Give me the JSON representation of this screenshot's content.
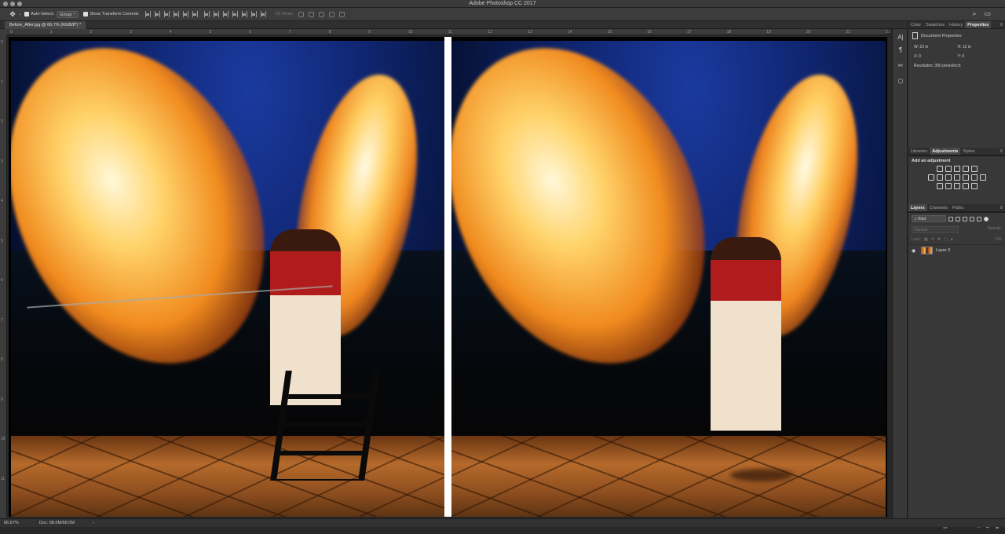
{
  "window": {
    "title": "Adobe Photoshop CC 2017"
  },
  "options_bar": {
    "auto_select_label": "Auto-Select:",
    "auto_select_value": "Group",
    "transform_label": "Show Transform Controls",
    "mode_3d_label": "3D Mode:"
  },
  "document": {
    "tab_title": "Before_After.jpg @ 66.7% (RGB/8*) *"
  },
  "rulers": {
    "h": [
      "0",
      "1",
      "2",
      "3",
      "4",
      "5",
      "6",
      "7",
      "8",
      "9",
      "10",
      "11",
      "12",
      "13",
      "14",
      "15",
      "16",
      "17",
      "18",
      "19",
      "20",
      "21",
      "22"
    ],
    "v": [
      "0",
      "1",
      "2",
      "3",
      "4",
      "5",
      "6",
      "7",
      "8",
      "9",
      "10",
      "11"
    ]
  },
  "properties_panel": {
    "tabs": [
      "Color",
      "Swatches",
      "History",
      "Properties"
    ],
    "active_tab": "Properties",
    "header": "Document Properties",
    "w": "W: 22 in",
    "h": "H: 12 in",
    "x": "X: 0",
    "y": "Y: 0",
    "resolution": "Resolution: 300 pixels/inch"
  },
  "adjustments_panel": {
    "tabs": [
      "Libraries",
      "Adjustments",
      "Styles"
    ],
    "active_tab": "Adjustments",
    "header": "Add an adjustment"
  },
  "layers_panel": {
    "tabs": [
      "Layers",
      "Channels",
      "Paths"
    ],
    "active_tab": "Layers",
    "kind_label": "Kind",
    "blend_mode": "Normal",
    "opacity_label": "Opacity:",
    "lock_label": "Lock:",
    "fill_label": "Fill:",
    "layers": [
      {
        "name": "Layer 0",
        "visible": true
      }
    ]
  },
  "status_bar": {
    "zoom": "66.67%",
    "doc_size": "Doc: 68.0M/68.0M"
  },
  "colors": {
    "accent_fire": "#f7b54a",
    "sky_blue": "#0f256f",
    "panel_bg": "#383838"
  }
}
